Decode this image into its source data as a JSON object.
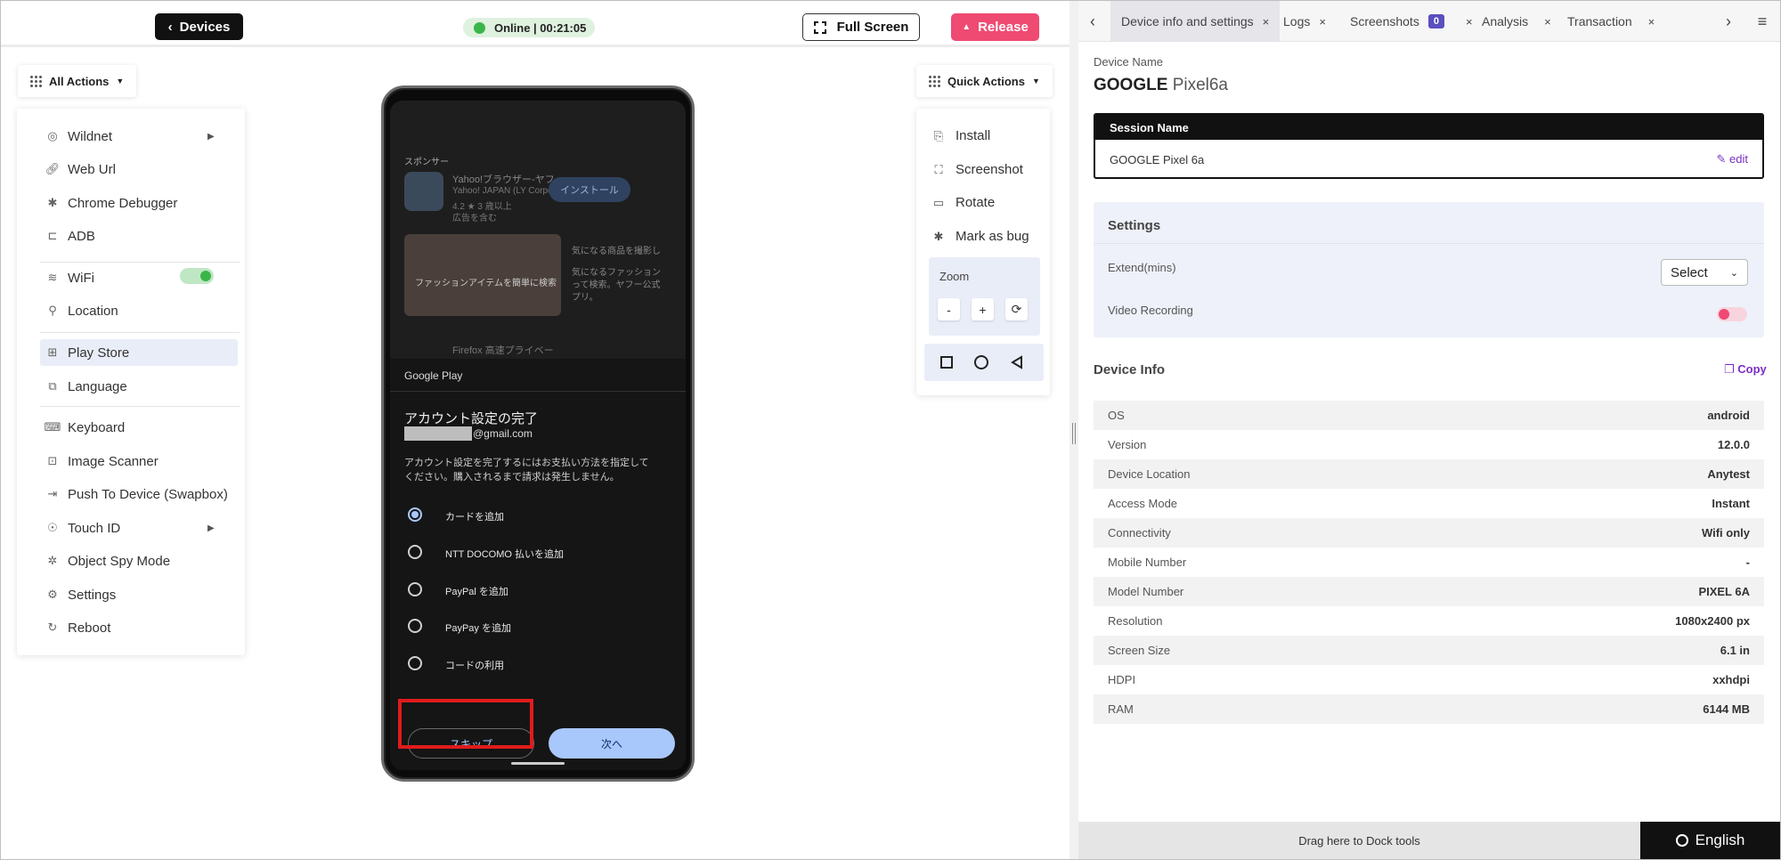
{
  "topbar": {
    "devices_label": "Devices",
    "status": "Online | 00:21:05",
    "fullscreen_label": "Full Screen",
    "release_label": "Release"
  },
  "all_actions": {
    "label": "All Actions",
    "items": [
      {
        "label": "Wildnet",
        "icon": "signal-icon"
      },
      {
        "label": "Web Url",
        "icon": "link-icon"
      },
      {
        "label": "Chrome Debugger",
        "icon": "bug-icon"
      },
      {
        "label": "ADB",
        "icon": "terminal-icon"
      },
      {
        "label": "WiFi",
        "icon": "wifi-icon"
      },
      {
        "label": "Location",
        "icon": "location-pin-icon"
      },
      {
        "label": "Play Store",
        "icon": "apps-icon"
      },
      {
        "label": "Language",
        "icon": "language-icon"
      },
      {
        "label": "Keyboard",
        "icon": "keyboard-icon"
      },
      {
        "label": "Image Scanner",
        "icon": "image-scanner-icon"
      },
      {
        "label": "Push To Device (Swapbox)",
        "icon": "push-icon"
      },
      {
        "label": "Touch ID",
        "icon": "fingerprint-icon"
      },
      {
        "label": "Object Spy Mode",
        "icon": "spy-icon"
      },
      {
        "label": "Settings",
        "icon": "gear-icon"
      },
      {
        "label": "Reboot",
        "icon": "reboot-icon"
      }
    ]
  },
  "quick_actions": {
    "label": "Quick Actions",
    "items": [
      {
        "label": "Install",
        "icon": "install-icon"
      },
      {
        "label": "Screenshot",
        "icon": "screenshot-icon"
      },
      {
        "label": "Rotate",
        "icon": "rotate-icon"
      },
      {
        "label": "Mark as bug",
        "icon": "bug-icon"
      }
    ],
    "zoom_label": "Zoom",
    "zoom_out": "-",
    "zoom_in": "+"
  },
  "phone": {
    "ad_header": "スポンサー",
    "ad_app_title": "Yahoo!ブラウザー-ヤフ...",
    "ad_app_dev": "Yahoo! JAPAN (LY Corporatio...",
    "ad_app_meta": "4.2 ★  3 歳以上",
    "ad_app_ad": "広告を含む",
    "ad_install": "インストール",
    "ad_banner_text": "ファッションアイテムを簡単に検索",
    "ad_side_text_1": "気になる商品を撮影し",
    "ad_side_text_2": "気になるファッション",
    "ad_side_text_3": "って検索。ヤフー公式",
    "ad_side_text_4": "プリ。",
    "ad_next_app": "Firefox 高速プライベー",
    "sheet_brand": "Google Play",
    "sheet_title": "アカウント設定の完了",
    "sheet_email_suffix": "@gmail.com",
    "sheet_desc_1": "アカウント設定を完了するにはお支払い方法を指定して",
    "sheet_desc_2": "ください。購入されるまで請求は発生しません。",
    "options": [
      "カードを追加",
      "NTT DOCOMO 払いを追加",
      "PayPal を追加",
      "PayPay を追加",
      "コードの利用"
    ],
    "skip_label": "スキップ",
    "next_label": "次へ"
  },
  "tabs": [
    {
      "label": "Device info and settings"
    },
    {
      "label": "Logs"
    },
    {
      "label": "Screenshots",
      "badge": "0"
    },
    {
      "label": "Analysis"
    },
    {
      "label": "Transaction"
    }
  ],
  "device": {
    "name_label": "Device Name",
    "brand": "GOOGLE",
    "model": "Pixel6a",
    "session_header": "Session Name",
    "session_value": "GOOGLE Pixel 6a",
    "edit_label": "edit"
  },
  "settings": {
    "title": "Settings",
    "extend_label": "Extend(mins)",
    "select_value": "Select",
    "video_label": "Video Recording"
  },
  "device_info": {
    "title": "Device Info",
    "copy_label": "Copy",
    "rows": [
      {
        "k": "OS",
        "v": "android"
      },
      {
        "k": "Version",
        "v": "12.0.0"
      },
      {
        "k": "Device Location",
        "v": "Anytest"
      },
      {
        "k": "Access Mode",
        "v": "Instant"
      },
      {
        "k": "Connectivity",
        "v": "Wifi only"
      },
      {
        "k": "Mobile Number",
        "v": "-"
      },
      {
        "k": "Model Number",
        "v": "PIXEL 6A"
      },
      {
        "k": "Resolution",
        "v": "1080x2400 px"
      },
      {
        "k": "Screen Size",
        "v": "6.1 in"
      },
      {
        "k": "HDPI",
        "v": "xxhdpi"
      },
      {
        "k": "RAM",
        "v": "6144 MB"
      }
    ]
  },
  "footer": {
    "dock_text": "Drag here to Dock tools",
    "language": "English"
  }
}
